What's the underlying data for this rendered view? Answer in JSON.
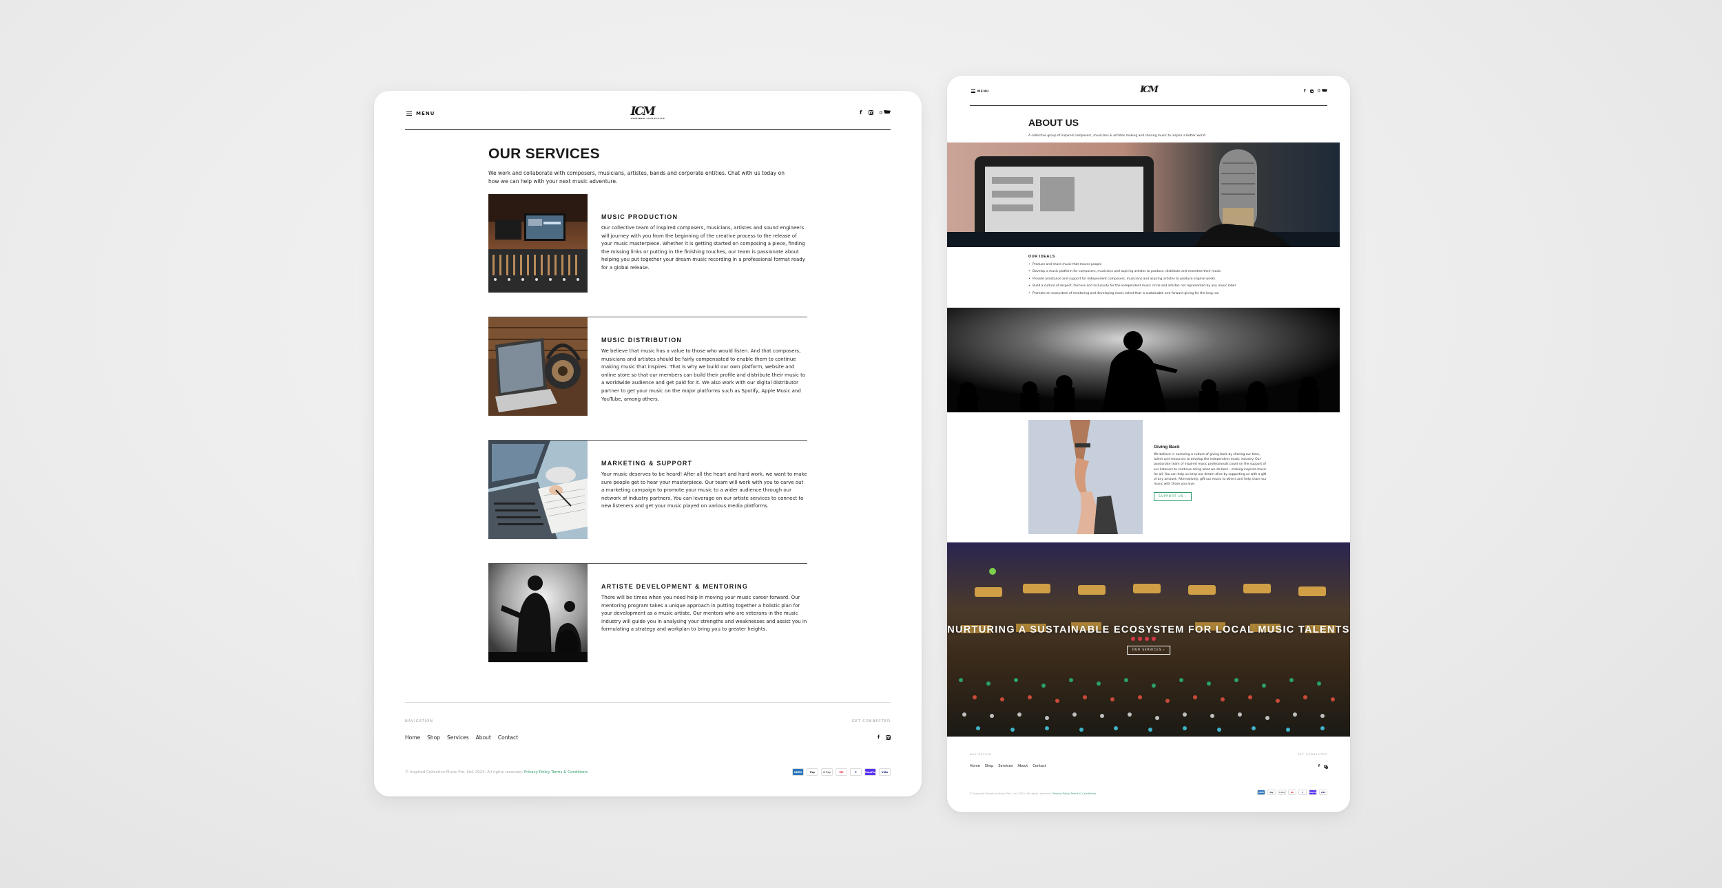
{
  "colors": {
    "accent": "#2f9a6a",
    "divider": "#555555"
  },
  "header": {
    "menu_label": "MENU",
    "logo_text": "ICM",
    "logo_sub": "INSPIRED COLLECTIVE",
    "facebook_icon": "f",
    "cart_count": "0"
  },
  "services_page": {
    "title": "OUR SERVICES",
    "intro": "We work and collaborate with composers, musicians, artistes, bands and corporate entities. Chat with us today on how we can help with your next music adventure.",
    "services": [
      {
        "title": "MUSIC PRODUCTION",
        "text": "Our collective team of inspired composers, musicians, artistes and sound engineers will journey with you from the beginning of the creative process to the release of your music masterpiece. Whether it is getting started on composing a piece, finding the missing links or putting in the finishing touches, our team is passionate about helping you put together your dream music recording in a professional format ready for a global release."
      },
      {
        "title": "MUSIC DISTRIBUTION",
        "text": "We believe that music has a value to those who would listen. And that composers, musicians and artistes should be fairly compensated to enable them to continue making music that inspires. That is why we build our own platform, website and online store so that our members can build their profile and distribute their music to a worldwide audience and get paid for it. We also work with our digital distributor partner to get your music on the major platforms such as Spotify, Apple Music and YouTube, among others."
      },
      {
        "title": "MARKETING & SUPPORT",
        "text": "Your music deserves to be heard! After all the heart and hard work, we want to make sure people get to hear your masterpiece. Our team will work with you to carve out a marketing campaign to promote your music to a wider audience through our network of industry partners. You can leverage on our artiste services to connect to new listeners and get your music played on various media platforms."
      },
      {
        "title": "ARTISTE DEVELOPMENT & MENTORING",
        "text": "There will be times when you need help in moving your music career forward. Our mentoring program takes a unique approach in putting together a holistic plan for your development as a music artiste. Our mentors who are veterans in the music industry will guide you in analysing your strengths and weaknesses and assist you in formulating a strategy and workplan to bring you to greater heights."
      }
    ]
  },
  "footer": {
    "nav_label": "NAVIGATION",
    "connect_label": "GET CONNECTED",
    "links": [
      "Home",
      "Shop",
      "Services",
      "About",
      "Contact"
    ],
    "copyright": "© Inspired Collective Music Pte. Ltd. 2024. All rights reserved.",
    "privacy": "Privacy Policy",
    "terms": "Terms & Conditions",
    "payments": [
      "AMEX",
      "Pay",
      "G Pay",
      "MC",
      "P",
      "ShopPay",
      "VISA"
    ]
  },
  "about_page": {
    "title": "ABOUT US",
    "subtitle": "A collective group of inspired composers, musicians & artistes making and sharing music to inspire a better world",
    "ideals_title": "OUR IDEALS",
    "ideals": [
      "Produce and share music that moves people",
      "Develop a music platform for composers, musicians and aspiring artistes to produce, distribute and monetise their music",
      "Provide assistance and support for independent composers, musicians and aspiring artistes to produce original works",
      "Build a culture of respect, fairness and inclusivity for the independent music circle and artistes not represented by any music label",
      "Promote an ecosystem of mentoring and developing music talent that is sustainable and forward giving for the long run"
    ],
    "giving_title": "Giving Back",
    "giving_text": "We believe in nurturing a culture of giving back by sharing our time, talent and resources to develop the independent music industry. Our passionate team of inspired music professionals count on the support of our listeners to continue doing what we do best – making inspired music for all. You can help us keep our dream alive by supporting us with a gift of any amount. Alternatively, gift our music to others and help share our music with those you love.",
    "giving_button": "SUPPORT US",
    "hero_title": "NURTURING A SUSTAINABLE ECOSYSTEM FOR LOCAL MUSIC TALENTS",
    "hero_button": "OUR SERVICES"
  }
}
